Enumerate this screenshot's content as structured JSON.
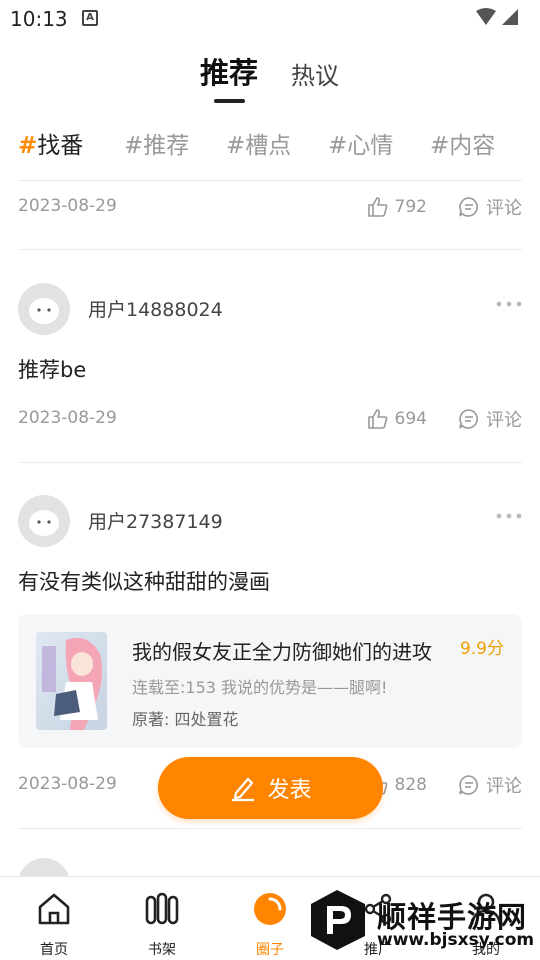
{
  "status": {
    "time": "10:13",
    "notif_glyph": "A"
  },
  "tabs": {
    "active": "推荐",
    "other": "热议"
  },
  "topics": [
    {
      "hash": "#",
      "label": "找番"
    },
    {
      "hash": "#",
      "label": "推荐"
    },
    {
      "hash": "#",
      "label": "槽点"
    },
    {
      "hash": "#",
      "label": "心情"
    },
    {
      "hash": "#",
      "label": "内容"
    }
  ],
  "posts": [
    {
      "date": "2023-08-29",
      "likes": "792",
      "comment_label": "评论"
    },
    {
      "username": "用户14888024",
      "text": "推荐be",
      "date": "2023-08-29",
      "likes": "694",
      "comment_label": "评论"
    },
    {
      "username": "用户27387149",
      "text": "有没有类似这种甜甜的漫画",
      "book": {
        "title": "我的假女友正全力防御她们的进攻",
        "score": "9.9分",
        "update": "连载至:153 我说的优势是——腿啊!",
        "author": "原著: 四处置花"
      },
      "date": "2023-08-29",
      "likes": "828",
      "comment_label": "评论"
    }
  ],
  "publish": {
    "label": "发表"
  },
  "nav": [
    {
      "label": "首页",
      "icon": "home-icon"
    },
    {
      "label": "书架",
      "icon": "bookshelf-icon"
    },
    {
      "label": "圈子",
      "icon": "circle-icon"
    },
    {
      "label": "推广",
      "icon": "share-icon"
    },
    {
      "label": "我的",
      "icon": "profile-icon"
    }
  ],
  "watermark": {
    "title": "顺祥手游网",
    "url": "www.bjsxsy.com"
  },
  "colors": {
    "accent": "#ff8500",
    "score": "#f0a000",
    "muted": "#999999"
  }
}
